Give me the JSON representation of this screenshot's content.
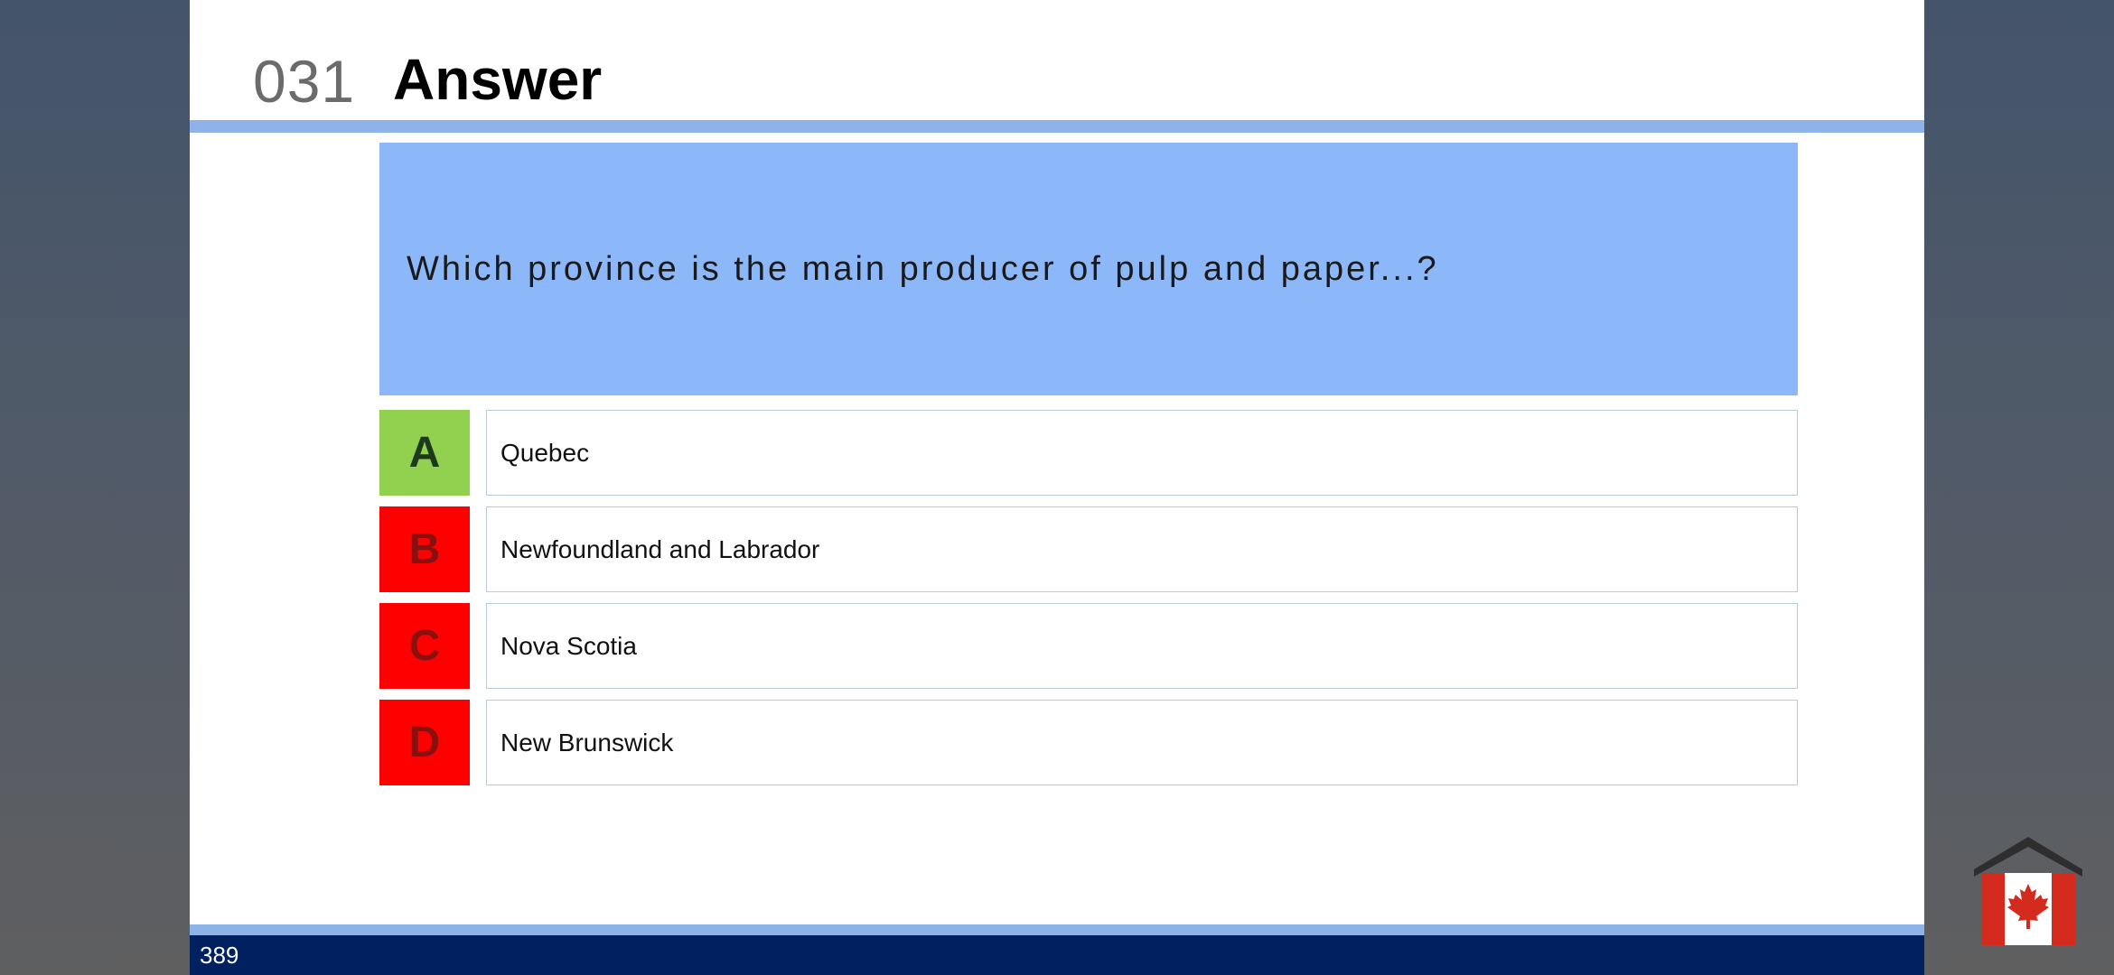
{
  "slide": {
    "number": "031",
    "title": "Answer",
    "page_number": "389"
  },
  "question": {
    "text": "Which province is the main producer of pulp and paper...?"
  },
  "options": [
    {
      "letter": "A",
      "text": "Quebec",
      "status": "correct"
    },
    {
      "letter": "B",
      "text": "Newfoundland and Labrador",
      "status": "wrong"
    },
    {
      "letter": "C",
      "text": "Nova Scotia",
      "status": "wrong"
    },
    {
      "letter": "D",
      "text": "New Brunswick",
      "status": "wrong"
    }
  ],
  "colors": {
    "correct": "#92d050",
    "wrong": "#ff0000",
    "question_background": "#8cb8fa",
    "accent_rule": "#8db3e8",
    "footer": "#002060"
  },
  "logo": {
    "icon": "house-canada-flag-icon"
  }
}
